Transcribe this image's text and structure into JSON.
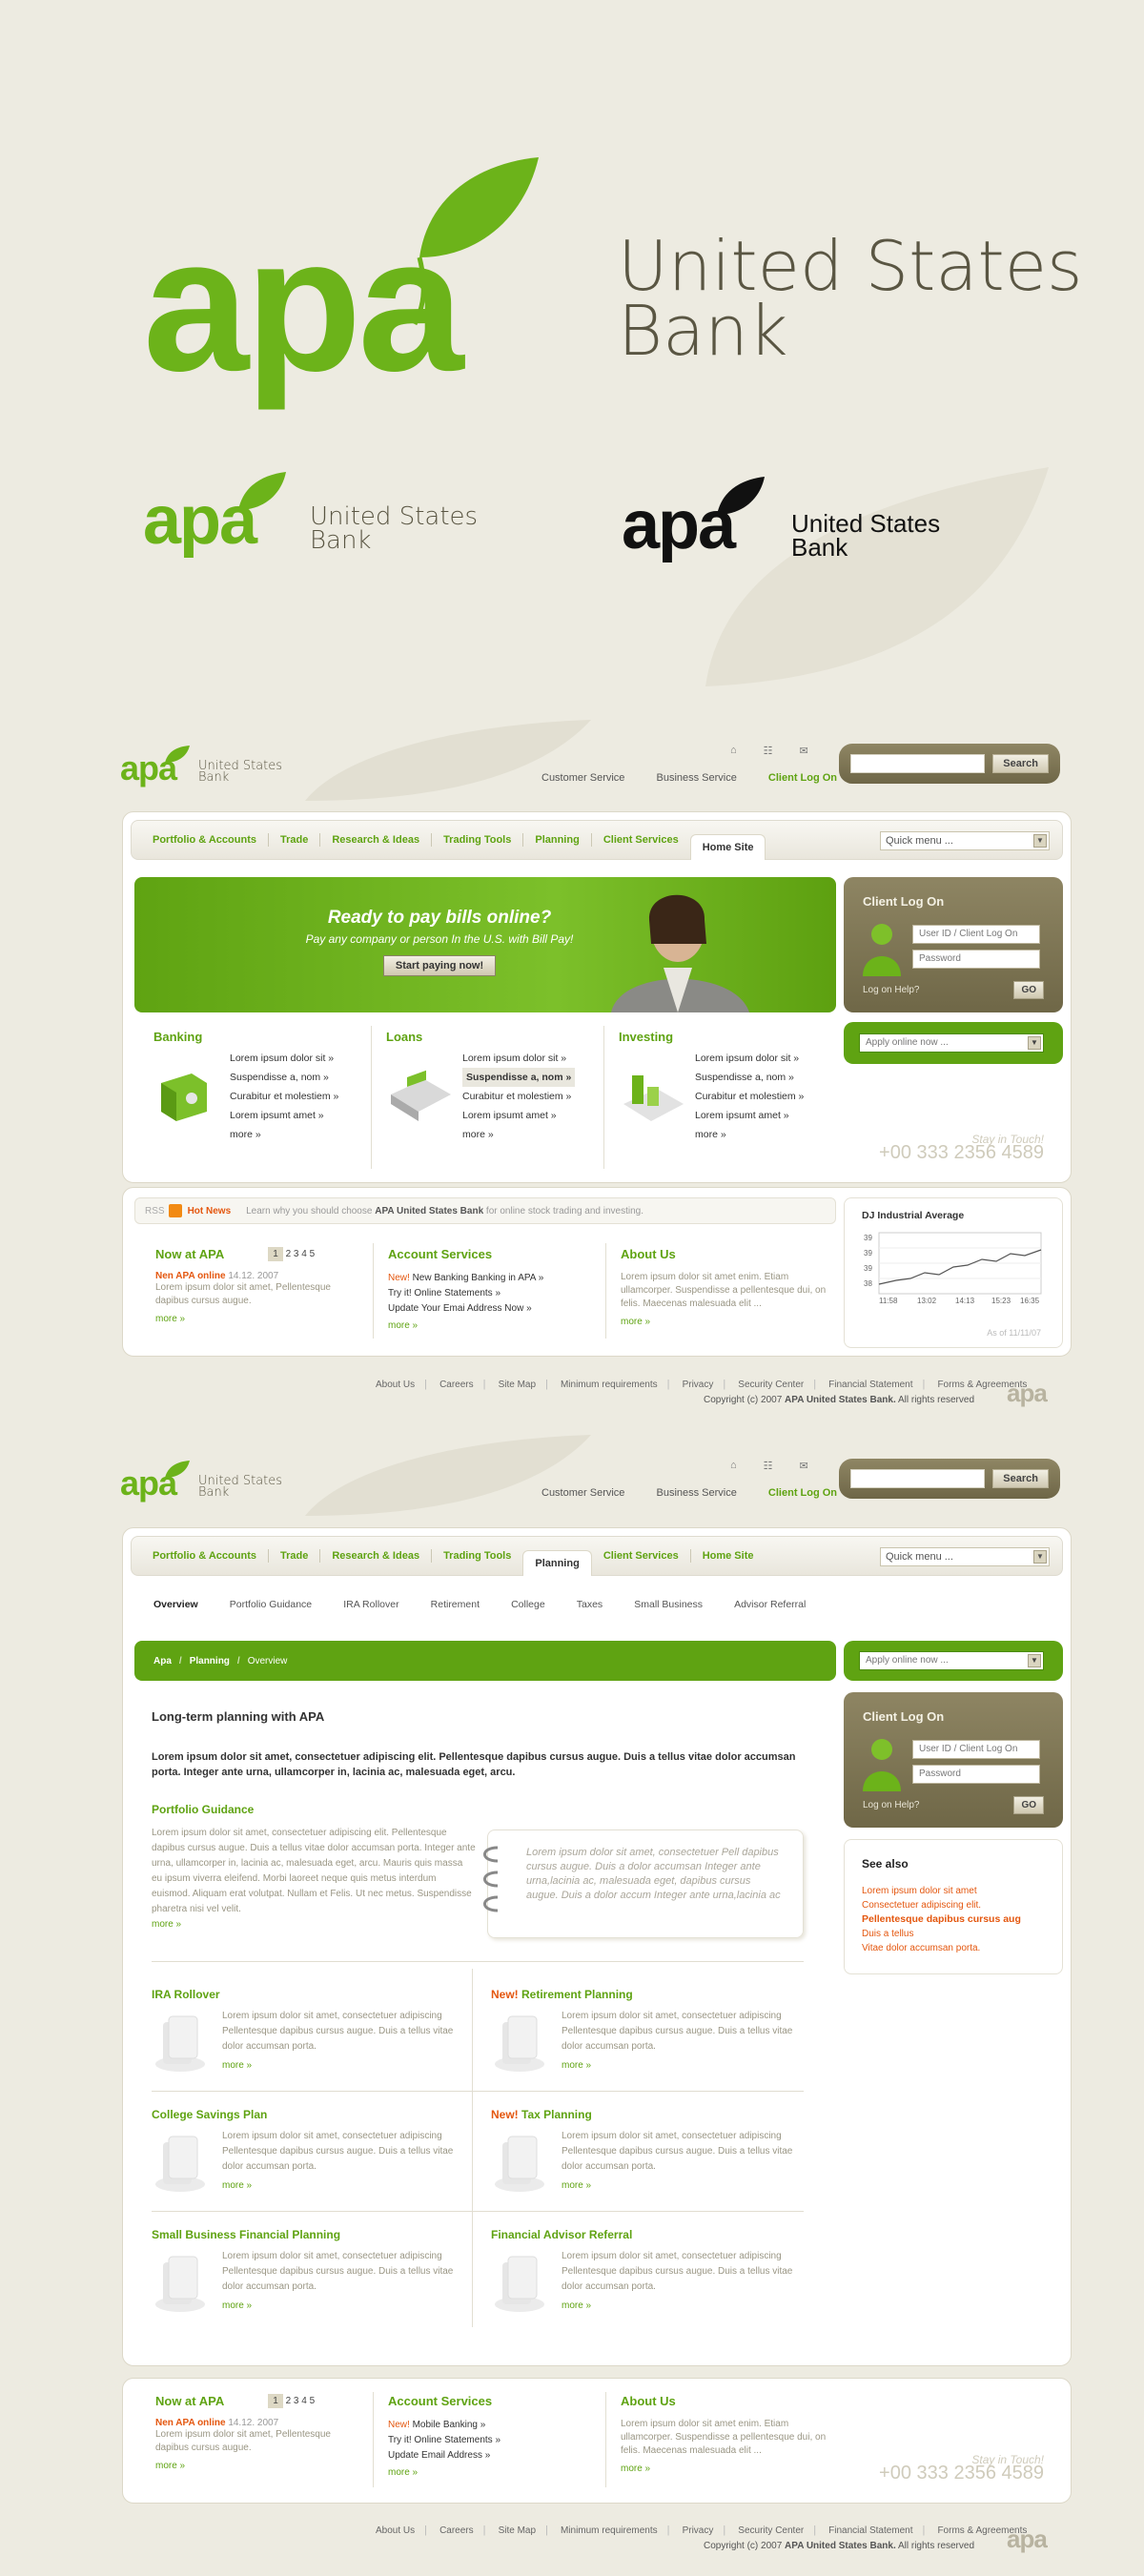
{
  "brand": {
    "name": "apa",
    "tagline_line1": "United States",
    "tagline_line2": "Bank"
  },
  "colors": {
    "brand_green": "#5fa312",
    "bg": "#edebe1",
    "olive": "#7a7152",
    "accent_orange": "#e4570f"
  },
  "header": {
    "links": [
      "Customer Service",
      "Business Service",
      "Client Log On"
    ],
    "search_button": "Search",
    "icons": [
      "home-icon",
      "sitemap-icon",
      "mail-icon"
    ]
  },
  "tabs": [
    "Portfolio & Accounts",
    "Trade",
    "Research & Ideas",
    "Trading Tools",
    "Planning",
    "Client Services",
    "Home Site"
  ],
  "quick_menu": "Quick menu ...",
  "hero": {
    "title": "Ready to pay bills online?",
    "subtitle": "Pay any company or person In the U.S. with Bill Pay!",
    "button": "Start paying now!"
  },
  "client_logon": {
    "title": "Client Log On",
    "user_placeholder": "User ID / Client Log On",
    "password_placeholder": "Password",
    "help": "Log on Help?",
    "go": "GO"
  },
  "apply": "Apply online now ...",
  "phone": {
    "label": "Stay in Touch!",
    "number": "+00 333 2356 4589"
  },
  "features": [
    {
      "title": "Banking",
      "items": [
        "Lorem ipsum dolor sit »",
        "Suspendisse a, nom »",
        "Curabitur et molestiem »",
        "Lorem ipsumt amet »"
      ],
      "more": "more »"
    },
    {
      "title": "Loans",
      "items": [
        "Lorem ipsum dolor sit »",
        "Suspendisse a, nom »",
        "Curabitur et molestiem »",
        "Lorem ipsumt amet »"
      ],
      "more": "more »"
    },
    {
      "title": "Investing",
      "items": [
        "Lorem ipsum dolor sit »",
        "Suspendisse a, nom »",
        "Curabitur et molestiem »",
        "Lorem ipsumt amet »"
      ],
      "more": "more »"
    }
  ],
  "hotnews": {
    "rss": "RSS",
    "label": "Hot News",
    "text_pre": "Learn why you should choose",
    "text_bold": "APA United States Bank",
    "text_post": "for online stock trading and investing."
  },
  "now_at_apa": {
    "title": "Now at APA",
    "pages": [
      "1",
      "2",
      "3",
      "4",
      "5"
    ],
    "item_title": "Nen APA online",
    "date": "14.12. 2007",
    "text": "Lorem ipsum dolor sit amet, Pellentesque dapibus cursus augue.",
    "more": "more »"
  },
  "account_services": {
    "title": "Account Services",
    "new": "New!",
    "items": [
      "New Banking Banking in APA »",
      "Try it! Online Statements »",
      "Update Your Emai Address Now »"
    ],
    "more": "more »"
  },
  "about_us": {
    "title": "About Us",
    "text": "Lorem ipsum dolor sit amet enim. Etiam ullamcorper. Suspendisse a pellentesque dui, on felis. Maecenas malesuada elit ...",
    "more": "more »"
  },
  "dj": {
    "title": "DJ Industrial Average",
    "y_ticks": [
      "39",
      "39",
      "39",
      "38"
    ],
    "x_ticks": [
      "11:58",
      "13:02",
      "14:13",
      "15:23",
      "16:35"
    ],
    "asof": "As of 11/11/07"
  },
  "footer": {
    "links": [
      "About Us",
      "Careers",
      "Site Map",
      "Minimum requirements",
      "Privacy",
      "Security Center",
      "Financial Statement",
      "Forms & Agreements"
    ],
    "copyright_pre": "Copyright (c) 2007",
    "copyright_bold": "APA United States Bank.",
    "copyright_post": "All rights reserved"
  },
  "planning": {
    "sub_nav": [
      "Overview",
      "Portfolio Guidance",
      "IRA Rollover",
      "Retirement",
      "College",
      "Taxes",
      "Small Business",
      "Advisor Referral"
    ],
    "breadcrumb": [
      "Apa",
      "Planning",
      "Overview"
    ],
    "title": "Long-term planning with APA",
    "intro": "Lorem ipsum dolor sit amet, consectetuer adipiscing elit. Pellentesque dapibus cursus augue. Duis a tellus vitae dolor accumsan porta. Integer ante urna, ullamcorper in, lacinia ac, malesuada eget, arcu.",
    "guidance_title": "Portfolio Guidance",
    "guidance_text": "Lorem ipsum dolor sit amet, consectetuer adipiscing elit. Pellentesque dapibus cursus augue. Duis a tellus vitae dolor accumsan porta. Integer ante urna, ullamcorper in, lacinia ac, malesuada eget, arcu. Mauris quis massa eu ipsum viverra eleifend. Morbi laoreet neque quis metus interdum euismod. Aliquam erat volutpat. Nullam et Felis. Ut nec metus. Suspendisse pharetra nisi vel velit.",
    "guidance_more": "more »",
    "quote": "Lorem ipsum dolor sit amet, consectetuer Pell dapibus cursus augue. Duis a dolor accumsan Integer ante urna,lacinia ac, malesuada eget, dapibus cursus augue. Duis a dolor accum Integer ante urna,lacinia ac",
    "services": [
      {
        "title": "IRA Rollover",
        "new": "",
        "text": "Lorem ipsum dolor sit amet, consectetuer adipiscing Pellentesque dapibus cursus augue. Duis a tellus vitae dolor accumsan porta.",
        "more": "more »"
      },
      {
        "title": "Retirement Planning",
        "new": "New!",
        "text": "Lorem ipsum dolor sit amet, consectetuer adipiscing Pellentesque dapibus cursus augue. Duis a tellus vitae dolor accumsan porta.",
        "more": "more »"
      },
      {
        "title": "College Savings Plan",
        "new": "",
        "text": "Lorem ipsum dolor sit amet, consectetuer adipiscing Pellentesque dapibus cursus augue. Duis a tellus vitae dolor accumsan porta.",
        "more": "more »"
      },
      {
        "title": "Tax Planning",
        "new": "New!",
        "text": "Lorem ipsum dolor sit amet, consectetuer adipiscing Pellentesque dapibus cursus augue. Duis a tellus vitae dolor accumsan porta.",
        "more": "more »"
      },
      {
        "title": "Small Business Financial Planning",
        "new": "",
        "text": "Lorem ipsum dolor sit amet, consectetuer adipiscing Pellentesque dapibus cursus augue. Duis a tellus vitae dolor accumsan porta.",
        "more": "more »"
      },
      {
        "title": "Financial Advisor Referral",
        "new": "",
        "text": "Lorem ipsum dolor sit amet, consectetuer adipiscing Pellentesque dapibus cursus augue. Duis a tellus vitae dolor accumsan porta.",
        "more": "more »"
      }
    ],
    "see_also": {
      "title": "See also",
      "items": [
        "Lorem ipsum dolor sit amet",
        "Consectetuer adipiscing elit.",
        "Pellentesque dapibus cursus aug",
        "Duis a tellus",
        "Vitae dolor accumsan porta."
      ]
    },
    "account_services_items": [
      "Mobile Banking »",
      "Try it! Online Statements »",
      "Update Email Address »"
    ]
  }
}
